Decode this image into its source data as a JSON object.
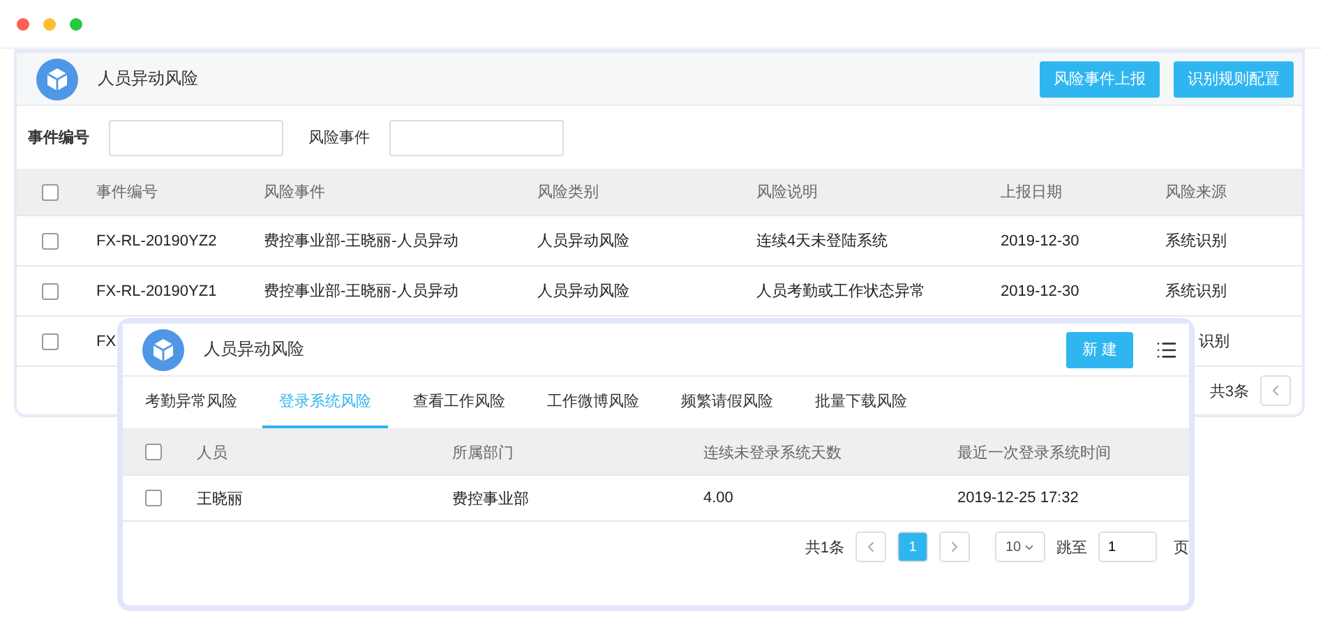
{
  "panel": {
    "title": "人员异动风险",
    "actions": [
      "风险事件上报",
      "识别规则配置"
    ],
    "filters": [
      {
        "label": "事件编号"
      },
      {
        "label": "风险事件"
      }
    ],
    "table": {
      "select_all_checked": false,
      "columns": [
        "事件编号",
        "风险事件",
        "风险类别",
        "风险说明",
        "上报日期",
        "风险来源"
      ],
      "rows": [
        {
          "checked": false,
          "covered": false,
          "cells": [
            "FX-RL-20190YZ2",
            "费控事业部-王晓丽-人员异动",
            "人员异动风险",
            "连续4天未登陆系统",
            "2019-12-30",
            "系统识别"
          ]
        },
        {
          "checked": false,
          "covered": false,
          "cells": [
            "FX-RL-20190YZ1",
            "费控事业部-王晓丽-人员异动",
            "人员异动风险",
            "人员考勤或工作状态异常",
            "2019-12-30",
            "系统识别"
          ]
        },
        {
          "checked": false,
          "covered": true,
          "cells": [
            "FX",
            "",
            "",
            "",
            "",
            "识别"
          ]
        }
      ]
    },
    "pagination": {
      "total": "共3条"
    }
  },
  "dialog": {
    "title": "人员异动风险",
    "new_button": "新 建",
    "tabs": [
      {
        "label": "考勤异常风险",
        "selected": false
      },
      {
        "label": "登录系统风险",
        "selected": true
      },
      {
        "label": "查看工作风险",
        "selected": false
      },
      {
        "label": "工作微博风险",
        "selected": false
      },
      {
        "label": "频繁请假风险",
        "selected": false
      },
      {
        "label": "批量下载风险",
        "selected": false
      }
    ],
    "table": {
      "select_all_checked": false,
      "columns": [
        "人员",
        "所属部门",
        "连续未登录系统天数",
        "最近一次登录系统时间"
      ],
      "rows": [
        {
          "checked": false,
          "cells": [
            "王晓丽",
            "费控事业部",
            "4.00",
            "2019-12-25 17:32"
          ]
        }
      ]
    },
    "pagination": {
      "total": "共1条",
      "pages": [
        {
          "label": "1",
          "selected": true
        }
      ],
      "page_size": "10",
      "jump_label": "跳至",
      "jump_value": "1",
      "page_unit": "页"
    }
  }
}
